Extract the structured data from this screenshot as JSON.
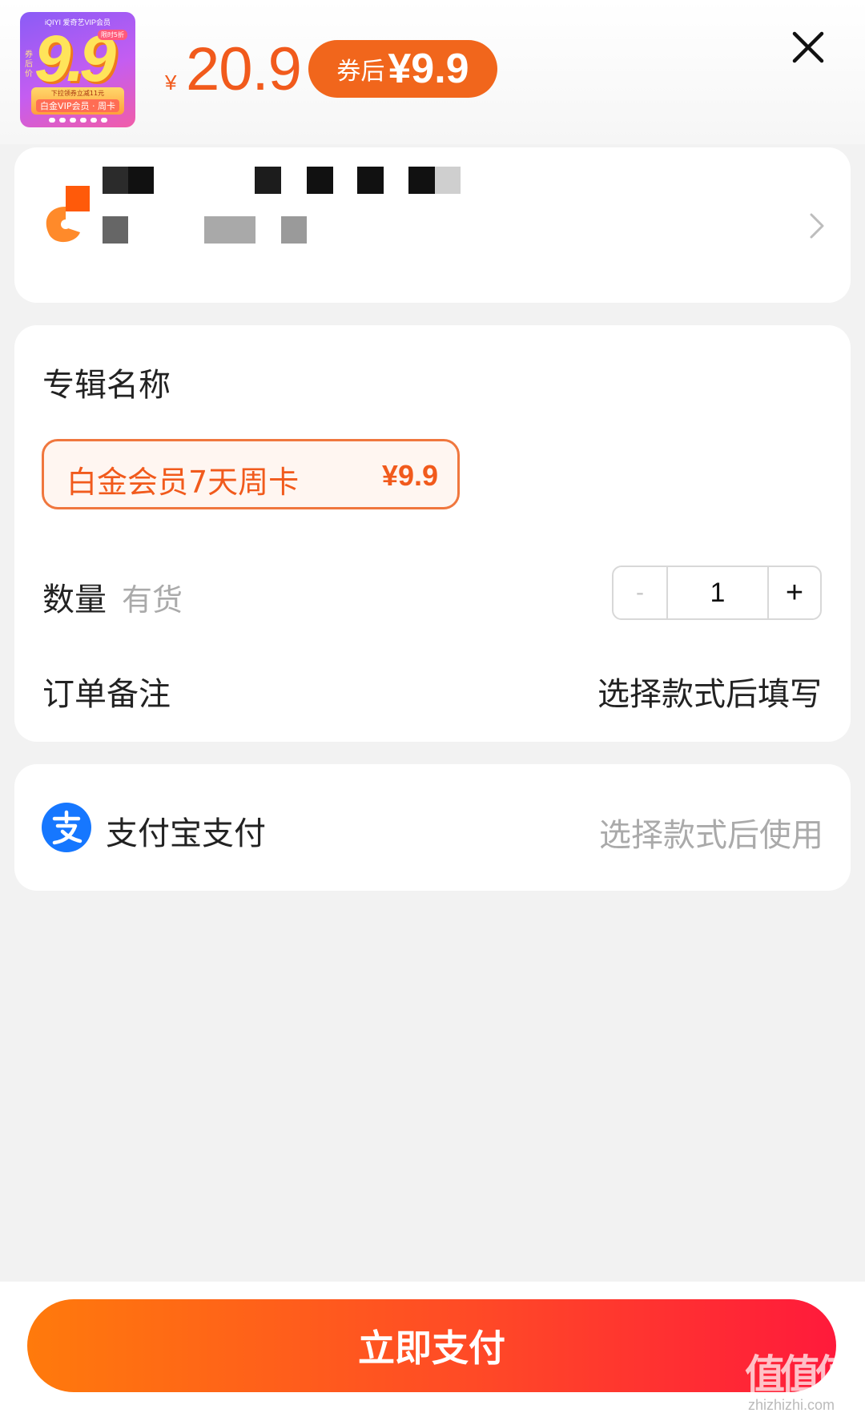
{
  "product": {
    "thumbnail": {
      "brand_text": "iQIYI 爱奇艺VIP会员",
      "side_text": "券后价",
      "big_price": "9.9",
      "tag_text": "限时5折",
      "strip_top": "下拉领券立减11元",
      "strip_bottom": "白金VIP会员 · 周卡"
    },
    "currency": "¥",
    "original_price": "20.9",
    "coupon_label": "券后",
    "coupon_price": "¥9.9"
  },
  "shop": {
    "icon": "shop-logo-icon",
    "chevron_icon": "chevron-right-icon"
  },
  "order": {
    "section_title": "专辑名称",
    "sku": {
      "name": "白金会员7天周卡",
      "price": "¥9.9",
      "selected": true
    },
    "quantity_label": "数量",
    "stock_status": "有货",
    "stepper": {
      "minus": "-",
      "value": "1",
      "plus": "+"
    },
    "remark_label": "订单备注",
    "remark_value": "选择款式后填写"
  },
  "payment": {
    "icon": "alipay-icon",
    "method_label": "支付宝支付",
    "status": "选择款式后使用"
  },
  "actions": {
    "pay_button": "立即支付"
  },
  "watermark": {
    "zh": "值值值",
    "en": "zhizhizhi.com"
  },
  "colors": {
    "accent": "#f15a1c",
    "coupon_bg": "#f1661c",
    "button_start": "#ff7a0c",
    "button_end": "#ff1a3b",
    "alipay_blue": "#1677ff"
  }
}
